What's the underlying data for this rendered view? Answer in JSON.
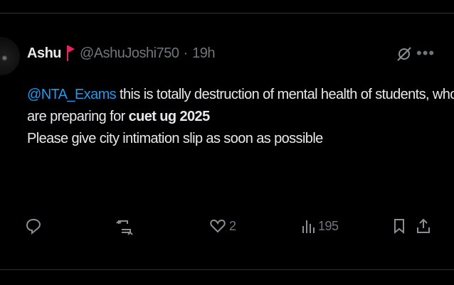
{
  "author": {
    "name": "Ashu",
    "handle": "@AshuJoshi750",
    "separator": "·",
    "time": "19h"
  },
  "tweet": {
    "mention": "@NTA_Exams",
    "line1_rest": " this is totally destruction of mental health of students, who",
    "line2_start": "are preparing for ",
    "line2_bold": "cuet ug 2025",
    "line3": "Please give city intimation slip as soon as possible"
  },
  "actions": {
    "replies": "",
    "reposts": "",
    "likes": "2",
    "views": "195"
  },
  "icons": {
    "more": "more-icon",
    "grok": "grok-icon",
    "reply": "reply-icon",
    "repost": "repost-icon",
    "like": "like-icon",
    "views": "views-icon",
    "bookmark": "bookmark-icon",
    "share": "share-icon"
  },
  "colors": {
    "background": "#000000",
    "text": "#e7e9ea",
    "muted": "#71767b",
    "link": "#1d9bf0",
    "flag": "#e0245e"
  }
}
